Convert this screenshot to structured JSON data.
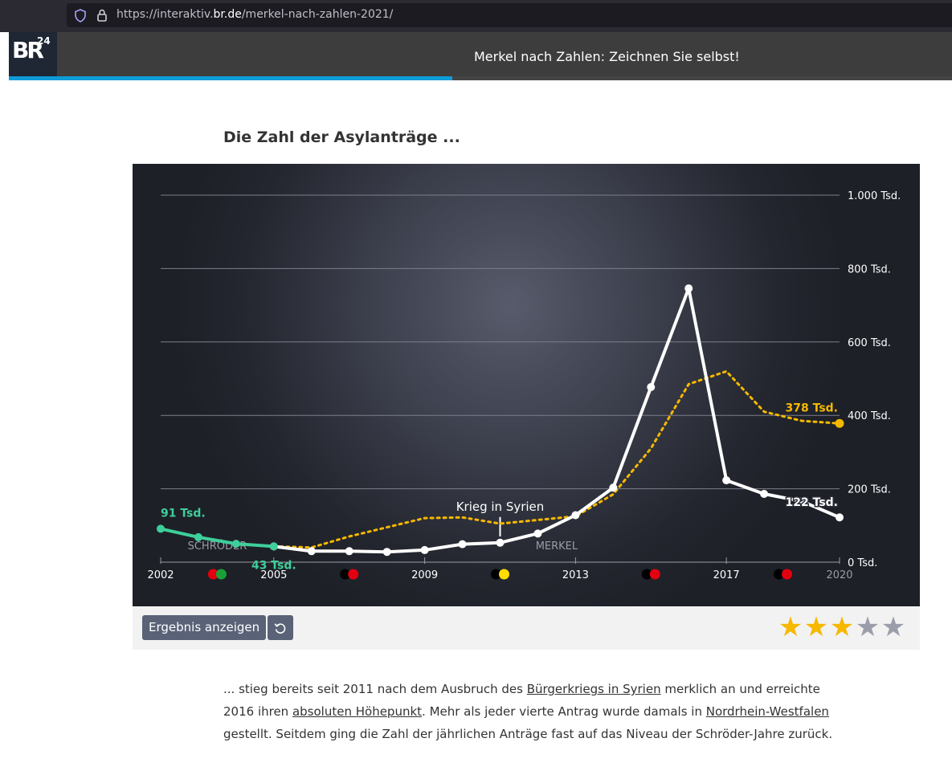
{
  "browser": {
    "url_prefix": "https://interaktiv.",
    "url_domain": "br.de",
    "url_path": "/merkel-nach-zahlen-2021/"
  },
  "header": {
    "logo_text": "BR",
    "logo_sup": "24",
    "title": "Merkel nach Zahlen: Zeichnen Sie selbst!",
    "progress_fraction": 0.47,
    "accent_color": "#0e9bd8"
  },
  "quiz": {
    "heading": "Die Zahl der Asylanträge ..."
  },
  "chart_data": {
    "type": "line",
    "xlim": [
      2002,
      2020
    ],
    "ylim": [
      0,
      1000
    ],
    "x_ticks": [
      2002,
      2005,
      2009,
      2013,
      2017,
      2020
    ],
    "y_ticks": [
      0,
      200,
      400,
      600,
      800,
      1000
    ],
    "y_tick_labels": [
      "0 Tsd.",
      "200 Tsd.",
      "400 Tsd.",
      "600 Tsd.",
      "800 Tsd.",
      "1.000 Tsd."
    ],
    "grid": true,
    "series": [
      {
        "role": "given",
        "color": "#3ecf9a",
        "x": [
          2002,
          2003,
          2004,
          2005
        ],
        "y": [
          91,
          68,
          50,
          43
        ]
      },
      {
        "role": "actual",
        "color": "#ffffff",
        "x": [
          2005,
          2006,
          2007,
          2008,
          2009,
          2010,
          2011,
          2012,
          2013,
          2014,
          2015,
          2016,
          2017,
          2018,
          2019,
          2020
        ],
        "y": [
          43,
          30,
          30,
          28,
          33,
          49,
          53,
          78,
          128,
          203,
          477,
          746,
          223,
          186,
          166,
          122
        ]
      },
      {
        "role": "user-drawn",
        "color": "#f6b800",
        "x": [
          2005,
          2006,
          2007,
          2008,
          2009,
          2010,
          2011,
          2012,
          2013,
          2014,
          2015,
          2016,
          2017,
          2018,
          2019,
          2020
        ],
        "y": [
          43,
          40,
          70,
          95,
          120,
          122,
          105,
          115,
          125,
          185,
          310,
          485,
          520,
          410,
          385,
          378
        ]
      }
    ],
    "labels": [
      {
        "text": "91 Tsd.",
        "x": 2002,
        "y": 91,
        "color": "#3ecf9a"
      },
      {
        "text": "43 Tsd.",
        "x": 2005,
        "y": 43,
        "color": "#3ecf9a"
      },
      {
        "text": "122 Tsd.",
        "x": 2020,
        "y": 122,
        "color": "#ffffff"
      },
      {
        "text": "378 Tsd.",
        "x": 2020,
        "y": 378,
        "color": "#f6b800"
      }
    ],
    "annotations": [
      {
        "text": "Krieg in Syrien",
        "x": 2011
      }
    ],
    "era_labels": [
      {
        "text": "SCHRÖDER",
        "x": 2003.5
      },
      {
        "text": "MERKEL",
        "x": 2012.5
      }
    ],
    "coalitions": [
      {
        "x": 2003.5,
        "colors": [
          "#e3000f",
          "#1aa037"
        ]
      },
      {
        "x": 2007,
        "colors": [
          "#000000",
          "#e3000f"
        ]
      },
      {
        "x": 2011,
        "colors": [
          "#000000",
          "#ffdd00"
        ]
      },
      {
        "x": 2015,
        "colors": [
          "#000000",
          "#e3000f"
        ]
      },
      {
        "x": 2018.5,
        "colors": [
          "#000000",
          "#e3000f"
        ]
      }
    ]
  },
  "controls": {
    "result_button_label": "Ergebnis anzeigen",
    "rating": 3,
    "rating_max": 5
  },
  "text": {
    "p1": "... stieg bereits seit 2011 nach dem Ausbruch des ",
    "link1": "Bürgerkriegs in Syrien",
    "p2": " merklich an und erreichte 2016 ihren ",
    "link2": "absoluten Höhepunkt",
    "p3": ". Mehr als jeder vierte Antrag wurde damals in ",
    "link3": "Nordrhein-Westfalen",
    "p4": " gestellt. Seitdem ging die Zahl der jährlichen Anträge fast auf das Niveau der Schröder-Jahre zurück."
  }
}
